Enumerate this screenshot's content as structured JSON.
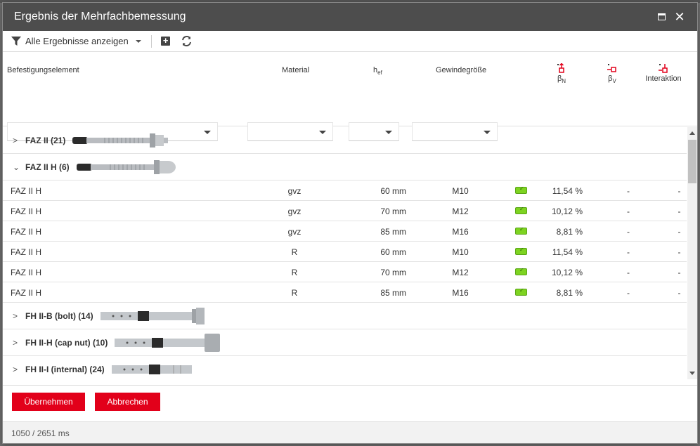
{
  "window": {
    "title": "Ergebnis der Mehrfachbemessung"
  },
  "toolbar": {
    "filter_label": "Alle Ergebnisse anzeigen"
  },
  "columns": {
    "element": "Befestigungselement",
    "material": "Material",
    "hef_main": "h",
    "hef_sub": "ef",
    "thread": "Gewindegröße",
    "bn_main": "β",
    "bn_sub": "N",
    "bv_main": "β",
    "bv_sub": "V",
    "interaction": "Interaktion"
  },
  "groups": [
    {
      "label": "FAZ II (21)",
      "expanded": false
    },
    {
      "label": "FAZ II H (6)",
      "expanded": true
    },
    {
      "label": "FH II-B (bolt) (14)",
      "expanded": false
    },
    {
      "label": "FH II-H (cap nut) (10)",
      "expanded": false
    },
    {
      "label": "FH II-I (internal) (24)",
      "expanded": false
    }
  ],
  "rows": [
    {
      "name": "FAZ II H",
      "material": "gvz",
      "hef": "60 mm",
      "thread": "M10",
      "bn": "11,54 %",
      "bv": "-",
      "interaction": "-"
    },
    {
      "name": "FAZ II H",
      "material": "gvz",
      "hef": "70 mm",
      "thread": "M12",
      "bn": "10,12 %",
      "bv": "-",
      "interaction": "-"
    },
    {
      "name": "FAZ II H",
      "material": "gvz",
      "hef": "85 mm",
      "thread": "M16",
      "bn": "8,81 %",
      "bv": "-",
      "interaction": "-"
    },
    {
      "name": "FAZ II H",
      "material": "R",
      "hef": "60 mm",
      "thread": "M10",
      "bn": "11,54 %",
      "bv": "-",
      "interaction": "-"
    },
    {
      "name": "FAZ II H",
      "material": "R",
      "hef": "70 mm",
      "thread": "M12",
      "bn": "10,12 %",
      "bv": "-",
      "interaction": "-"
    },
    {
      "name": "FAZ II H",
      "material": "R",
      "hef": "85 mm",
      "thread": "M16",
      "bn": "8,81 %",
      "bv": "-",
      "interaction": "-"
    }
  ],
  "buttons": {
    "accept": "Übernehmen",
    "cancel": "Abbrechen"
  },
  "status": {
    "timing": "1050 / 2651 ms"
  },
  "colors": {
    "titlebar": "#4d4d4d",
    "accent_red": "#e2001a",
    "ok_green": "#7ed321"
  }
}
